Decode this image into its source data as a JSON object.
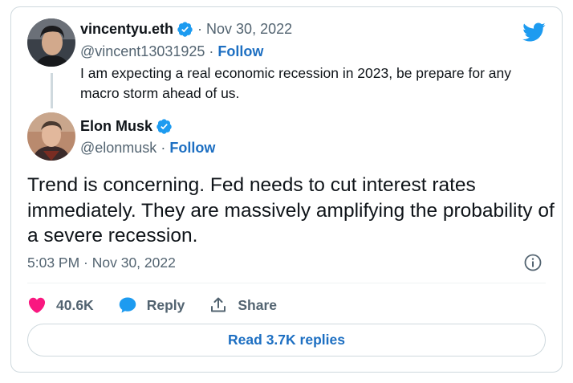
{
  "quoted_tweet": {
    "name": "vincentyu.eth",
    "date": "Nov 30, 2022",
    "handle": "@vincent13031925",
    "follow_label": "Follow",
    "separator": "·",
    "text": "I am expecting a real economic recession in 2023, be prepare for any macro storm ahead of us."
  },
  "tweet": {
    "name": "Elon Musk",
    "handle": "@elonmusk",
    "follow_label": "Follow",
    "separator": "·",
    "text": "Trend is concerning. Fed needs to cut interest rates immediately. They are massively amplifying the probability of a severe recession.",
    "timestamp": "5:03 PM · Nov 30, 2022"
  },
  "actions": {
    "like_count": "40.6K",
    "reply_label": "Reply",
    "share_label": "Share"
  },
  "read_replies_label": "Read 3.7K replies",
  "icons": {
    "brand": "twitter-bird-icon",
    "verified": "verified-badge-icon",
    "info": "info-icon",
    "like": "heart-icon",
    "reply": "speech-bubble-icon",
    "share": "upload-arrow-icon"
  },
  "colors": {
    "brand_blue": "#1d9bf0",
    "link_blue": "#1d6fc2",
    "like_pink": "#f91880",
    "muted_text": "#536471",
    "border": "#cfd9de"
  }
}
